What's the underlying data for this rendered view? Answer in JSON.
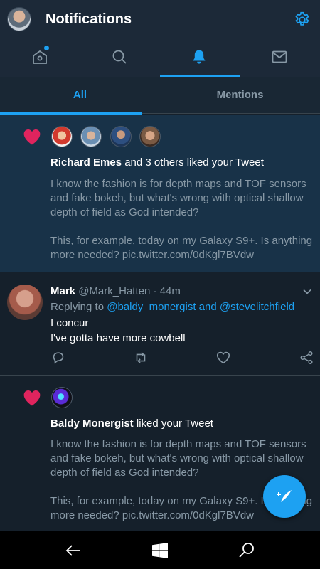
{
  "header": {
    "title": "Notifications",
    "avatar_icon": "profile-avatar",
    "settings_icon": "gear-icon"
  },
  "icon_tabs": [
    {
      "icon": "home-icon",
      "has_dot": true
    },
    {
      "icon": "search-icon"
    },
    {
      "icon": "bell-icon",
      "active": true
    },
    {
      "icon": "mail-icon"
    }
  ],
  "sub_tabs": {
    "all": "All",
    "mentions": "Mentions"
  },
  "notifications": {
    "first": {
      "actor": "Richard Emes",
      "suffix": " and 3 others liked your Tweet",
      "text": "I know the fashion is for depth maps and TOF sensors and fake bokeh, but what's wrong with optical shallow depth of field as God intended?\n\nThis, for example, today on my Galaxy S9+. Is anything more needed? pic.twitter.com/0dKgl7BVdw"
    },
    "reply": {
      "name": "Mark",
      "handle": "@Mark_Hatten",
      "time": " · 44m",
      "replying_label": "Replying to ",
      "replying_to": "@baldy_monergist and @stevelitchfield",
      "body": "I concur\nI've gotta have more cowbell"
    },
    "second": {
      "actor": "Baldy Monergist",
      "suffix": " liked your Tweet",
      "text": "I know the fashion is for depth maps and TOF sensors and fake bokeh, but what's wrong with optical shallow depth of field as God intended?\n\nThis, for example, today on my Galaxy S9+. Is anything more needed? pic.twitter.com/0dKgl7BVdw"
    }
  },
  "colors": {
    "accent": "#1da1f2",
    "like": "#e0245e",
    "background": "#15202b",
    "header": "#1c2938",
    "muted_text": "#8899a6"
  },
  "navbar": {
    "back_icon": "back-arrow-icon",
    "windows_icon": "windows-logo-icon",
    "search_icon": "search-icon"
  },
  "fab": {
    "icon": "compose-tweet-icon"
  }
}
